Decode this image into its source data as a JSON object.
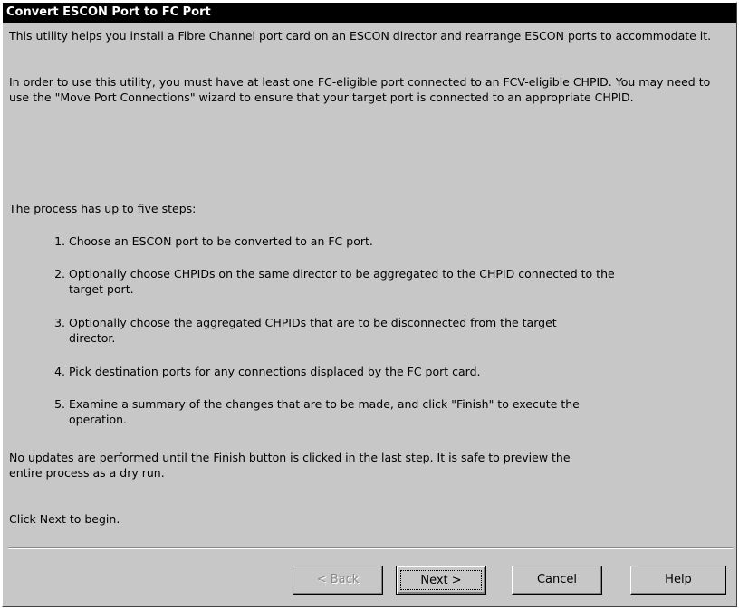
{
  "window": {
    "title": "Convert ESCON Port to FC Port"
  },
  "intro": {
    "para1": "This utility helps you install a Fibre Channel port card on an ESCON director and rearrange ESCON ports to accommodate it.",
    "para2": "In order to use this utility, you must have at least one FC-eligible port connected to an FCV-eligible CHPID. You may need to use the \"Move Port Connections\" wizard to ensure that your target port is connected to an appropriate CHPID.",
    "steps_heading": "The process has up to five steps:"
  },
  "steps": [
    {
      "num": "1.",
      "text": "Choose an ESCON port to be converted to an FC port."
    },
    {
      "num": "2.",
      "text": "Optionally choose CHPIDs on the same director to be aggregated to the CHPID connected to the target port."
    },
    {
      "num": "3.",
      "text": "Optionally choose the aggregated CHPIDs that are to be disconnected from the target director."
    },
    {
      "num": "4.",
      "text": "Pick destination ports for any connections displaced by the FC port card."
    },
    {
      "num": "5.",
      "text": "Examine a summary of the changes that are to be made, and click \"Finish\" to execute the operation."
    }
  ],
  "footer_text": {
    "note": "No updates are performed until the Finish button is clicked in the last step. It is safe to preview the entire process as a dry run.",
    "begin": "Click Next to begin."
  },
  "buttons": {
    "back": "< Back",
    "next": "Next >",
    "cancel": "Cancel",
    "help": "Help"
  },
  "colors": {
    "title_bar": "#000000",
    "dialog_bg": "#c7c7c7"
  }
}
